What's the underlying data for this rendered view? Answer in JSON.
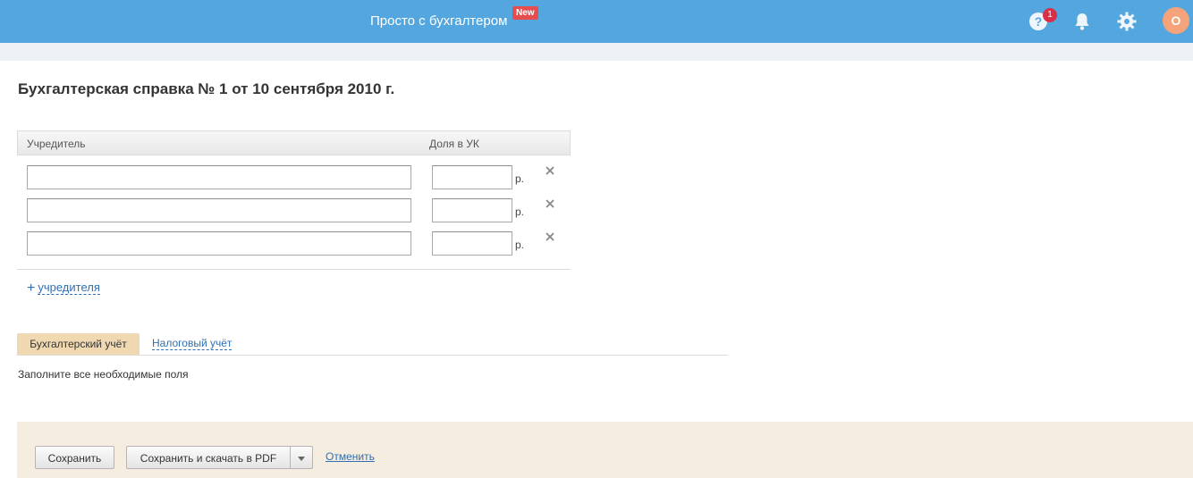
{
  "header": {
    "brand": "Просто с бухгалтером",
    "new_badge": "New",
    "help_count": "1",
    "avatar_initial": "О",
    "icons": [
      "help-icon",
      "bell-icon",
      "gear-icon"
    ],
    "color": "#54a7de"
  },
  "page": {
    "title": "Бухгалтерская справка № 1 от 10 сентября 2010 г."
  },
  "founders_grid": {
    "columns": [
      "Учредитель",
      "Доля в УК"
    ],
    "rows": [
      {
        "name": "",
        "share": "",
        "currency": "р."
      },
      {
        "name": "",
        "share": "",
        "currency": "р."
      },
      {
        "name": "",
        "share": "",
        "currency": "р."
      }
    ],
    "add_label": "учредителя"
  },
  "tabs": {
    "active": "Бухгалтерский учёт",
    "other": "Налоговый учёт"
  },
  "hint": "Заполните все необходимые поля",
  "footer": {
    "save": "Сохранить",
    "save_pdf": "Сохранить и скачать в PDF",
    "cancel": "Отменить"
  }
}
